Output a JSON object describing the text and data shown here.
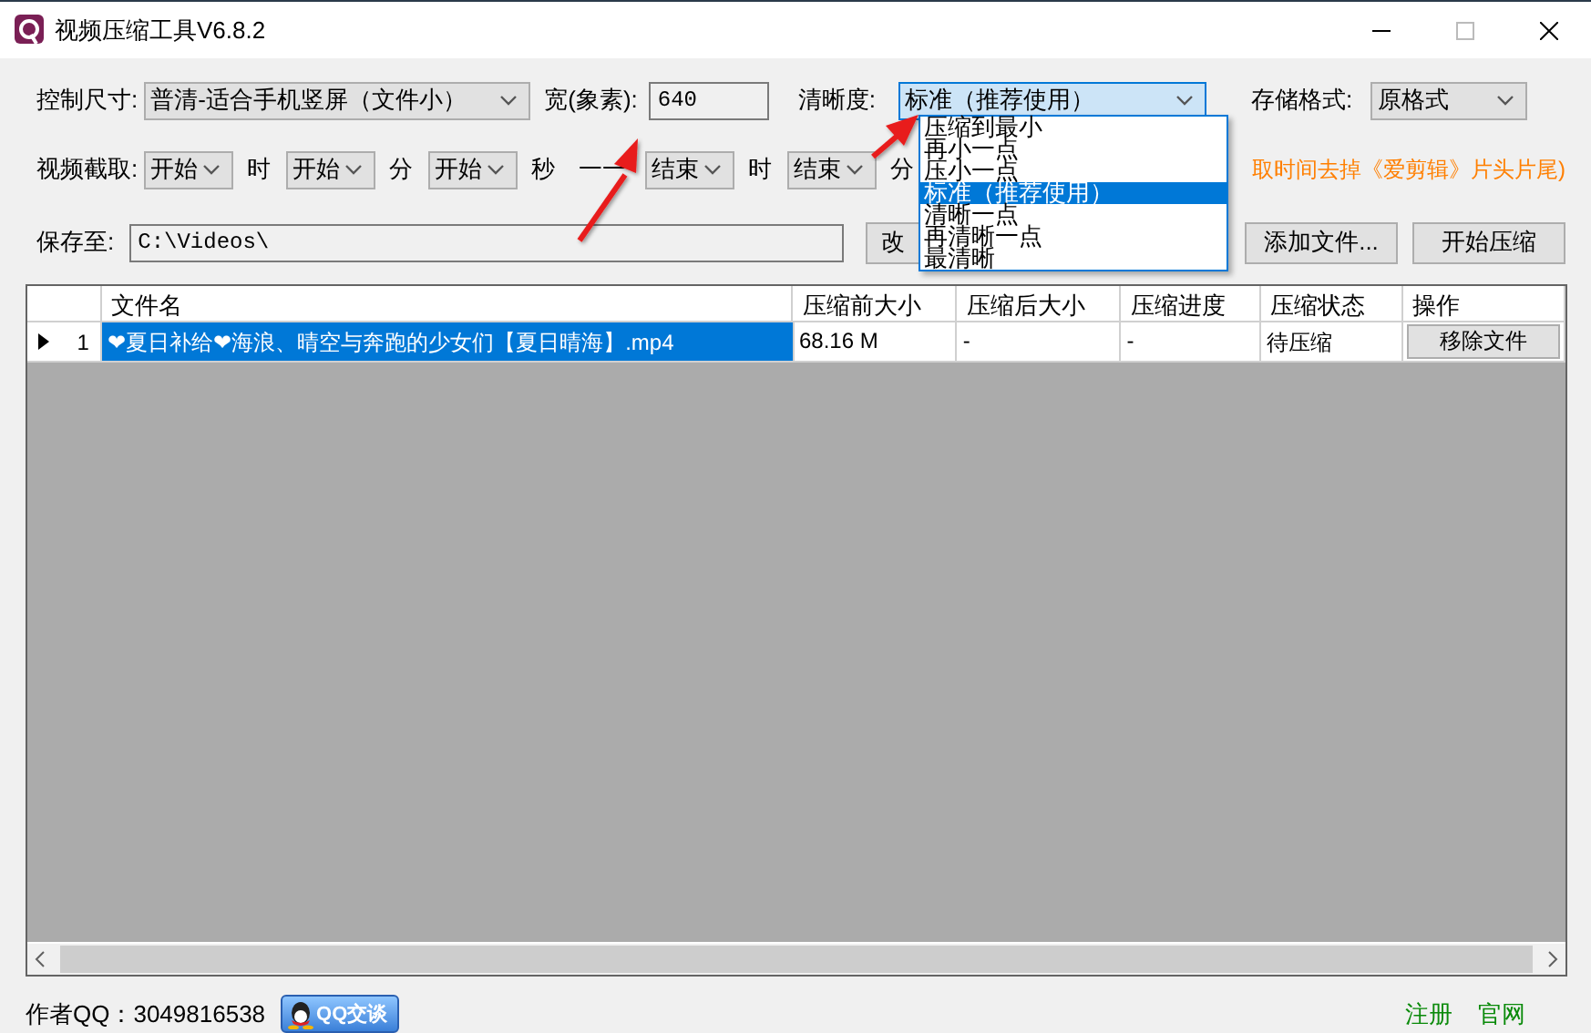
{
  "window": {
    "title": "视频压缩工具V6.8.2"
  },
  "size_row": {
    "size_label": "控制尺寸:",
    "size_value": "普清-适合手机竖屏（文件小）",
    "width_label": "宽(象素):",
    "width_value": "640",
    "clarity_label": "清晰度:",
    "clarity_value": "标准（推荐使用）",
    "format_label": "存储格式:",
    "format_value": "原格式"
  },
  "clarity_dropdown": {
    "items": [
      {
        "label": "压缩到最小",
        "selected": false
      },
      {
        "label": "再小一点",
        "selected": false
      },
      {
        "label": "压小一点",
        "selected": false
      },
      {
        "label": "标准（推荐使用）",
        "selected": true
      },
      {
        "label": "清晰一点",
        "selected": false
      },
      {
        "label": "再清晰一点",
        "selected": false
      },
      {
        "label": "最清晰",
        "selected": false
      }
    ]
  },
  "trim_row": {
    "label": "视频截取:",
    "items": [
      {
        "kind": "combo",
        "text": "开始"
      },
      {
        "kind": "label",
        "text": "时"
      },
      {
        "kind": "combo",
        "text": "开始"
      },
      {
        "kind": "label",
        "text": "分"
      },
      {
        "kind": "combo",
        "text": "开始"
      },
      {
        "kind": "label",
        "text": "秒"
      },
      {
        "kind": "label",
        "text": "一一"
      },
      {
        "kind": "combo",
        "text": "结束"
      },
      {
        "kind": "label",
        "text": "时"
      },
      {
        "kind": "combo",
        "text": "结束"
      },
      {
        "kind": "label",
        "text": "分"
      }
    ],
    "note": "取时间去掉《爱剪辑》片头片尾)"
  },
  "save_row": {
    "label": "保存至:",
    "path": "C:\\Videos\\",
    "change_button": "改",
    "add_button": "添加文件...",
    "start_button": "开始压缩"
  },
  "table": {
    "columns": [
      "文件名",
      "压缩前大小",
      "压缩后大小",
      "压缩进度",
      "压缩状态",
      "操作"
    ],
    "rows": [
      {
        "index": "1",
        "selected": true,
        "cells": [
          "❤夏日补给❤海浪、晴空与奔跑的少女们【夏日晴海】.mp4",
          "68.16 M",
          "-",
          "-",
          "待压缩"
        ],
        "action": "移除文件"
      }
    ]
  },
  "footer": {
    "author": "作者QQ：3049816538",
    "qq_button": "QQ交谈",
    "links": [
      "注册",
      "官网"
    ]
  }
}
